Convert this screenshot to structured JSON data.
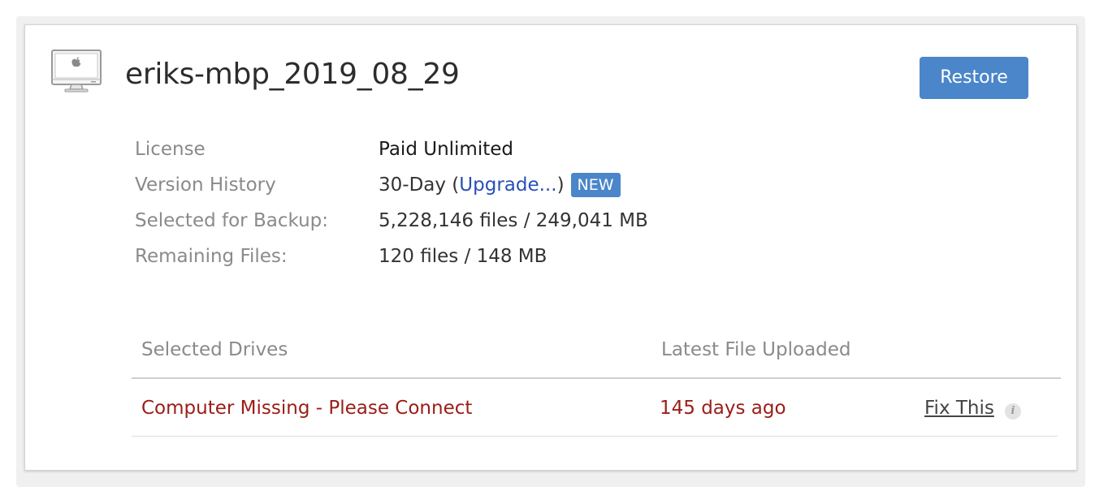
{
  "computer": {
    "icon": "apple-imac-icon",
    "name": "eriks-mbp_2019_08_29"
  },
  "actions": {
    "restore_label": "Restore"
  },
  "details": {
    "license": {
      "label": "License",
      "value": "Paid Unlimited"
    },
    "version_history": {
      "label": "Version History",
      "value_prefix": "30-Day (",
      "link_text": "Upgrade...",
      "value_suffix": ")",
      "badge": "NEW"
    },
    "selected_for_backup": {
      "label": "Selected for Backup:",
      "value": "5,228,146 files / 249,041 MB"
    },
    "remaining_files": {
      "label": "Remaining Files:",
      "value": "120 files / 148 MB"
    }
  },
  "drives_table": {
    "headers": {
      "drives": "Selected Drives",
      "latest": "Latest File Uploaded"
    },
    "rows": [
      {
        "drive": "Computer Missing - Please Connect",
        "latest": "145 days ago",
        "action": "Fix This",
        "info_icon": "i"
      }
    ]
  },
  "colors": {
    "accent": "#4a86c9",
    "link": "#2750b7",
    "error": "#9b1c17",
    "label": "#8a8a8a"
  }
}
